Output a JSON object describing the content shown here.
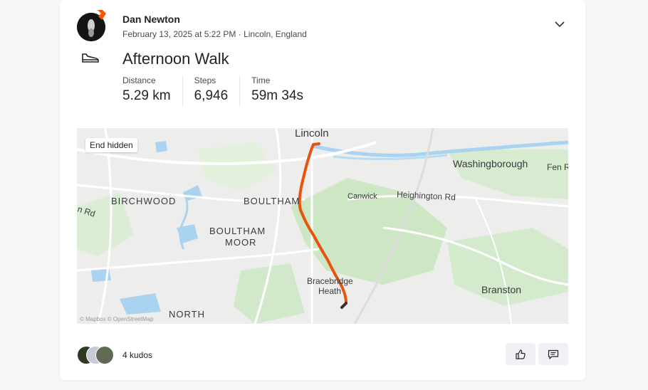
{
  "athlete": {
    "name": "Dan Newton"
  },
  "activity": {
    "meta": "February 13, 2025 at 5:22 PM · Lincoln, England",
    "title": "Afternoon Walk",
    "type_icon": "shoe-icon",
    "stats": [
      {
        "label": "Distance",
        "value": "5.29 km"
      },
      {
        "label": "Steps",
        "value": "6,946"
      },
      {
        "label": "Time",
        "value": "59m 34s"
      }
    ]
  },
  "map": {
    "badge": "End hidden",
    "attribution": "© Mapbox © OpenStreetMap",
    "labels": {
      "lincoln": "Lincoln",
      "washingborough": "Washingborough",
      "fen": "Fen R",
      "canwick": "Canwick",
      "heighington": "Heighington Rd",
      "birchwood": "BIRCHWOOD",
      "boultham": "BOULTHAM",
      "boultham_moor_1": "BOULTHAM",
      "boultham_moor_2": "MOOR",
      "bracebridge_1": "Bracebridge",
      "bracebridge_2": "Heath",
      "branston": "Branston",
      "north": "NORTH",
      "road_left": "n Rd"
    },
    "route_color": "#e8530e"
  },
  "kudos": {
    "label": "4 kudos"
  },
  "colors": {
    "brand": "#fc5200",
    "route": "#e8530e"
  }
}
